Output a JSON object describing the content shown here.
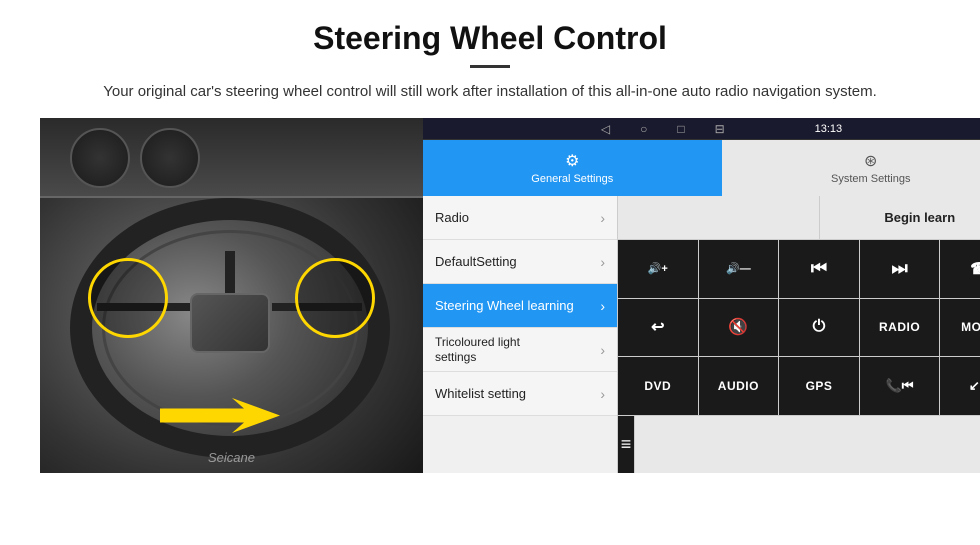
{
  "page": {
    "title": "Steering Wheel Control",
    "subtitle": "Your original car's steering wheel control will still work after installation of this all-in-one auto radio navigation system."
  },
  "android": {
    "status_bar": {
      "time": "13:13",
      "icons": [
        "gps-icon",
        "wifi-icon",
        "signal-icon"
      ]
    },
    "nav_bar": {
      "items": [
        "back-icon",
        "home-icon",
        "square-icon",
        "menu-icon"
      ]
    },
    "tabs": [
      {
        "label": "General Settings",
        "icon": "⚙️",
        "active": true
      },
      {
        "label": "System Settings",
        "icon": "🌐",
        "active": false
      }
    ],
    "menu_items": [
      {
        "label": "Radio",
        "active": false,
        "two_line": false
      },
      {
        "label": "DefaultSetting",
        "active": false,
        "two_line": false
      },
      {
        "label": "Steering Wheel learning",
        "active": true,
        "two_line": false
      },
      {
        "label": "Tricoloured light settings",
        "active": false,
        "two_line": true
      },
      {
        "label": "Whitelist setting",
        "active": false,
        "two_line": false
      }
    ],
    "begin_learn_label": "Begin learn",
    "control_buttons": {
      "row1": [
        {
          "label": "🔊+",
          "type": "icon"
        },
        {
          "label": "🔊—",
          "type": "icon"
        },
        {
          "label": "⏮",
          "type": "icon"
        },
        {
          "label": "⏭",
          "type": "icon"
        },
        {
          "label": "📞",
          "type": "icon"
        }
      ],
      "row2": [
        {
          "label": "↩",
          "type": "icon"
        },
        {
          "label": "🔇",
          "type": "icon"
        },
        {
          "label": "⏻",
          "type": "icon"
        },
        {
          "label": "RADIO",
          "type": "text"
        },
        {
          "label": "MODE",
          "type": "text"
        }
      ],
      "row3": [
        {
          "label": "DVD",
          "type": "text"
        },
        {
          "label": "AUDIO",
          "type": "text"
        },
        {
          "label": "GPS",
          "type": "text"
        },
        {
          "label": "📞⏮",
          "type": "icon"
        },
        {
          "label": "↙⏭",
          "type": "icon"
        }
      ],
      "row4": [
        {
          "label": "≡",
          "type": "icon"
        }
      ]
    }
  },
  "watermark": "Seicane",
  "icons": {
    "gear": "⚙",
    "globe": "🌐",
    "chevron": "›"
  }
}
